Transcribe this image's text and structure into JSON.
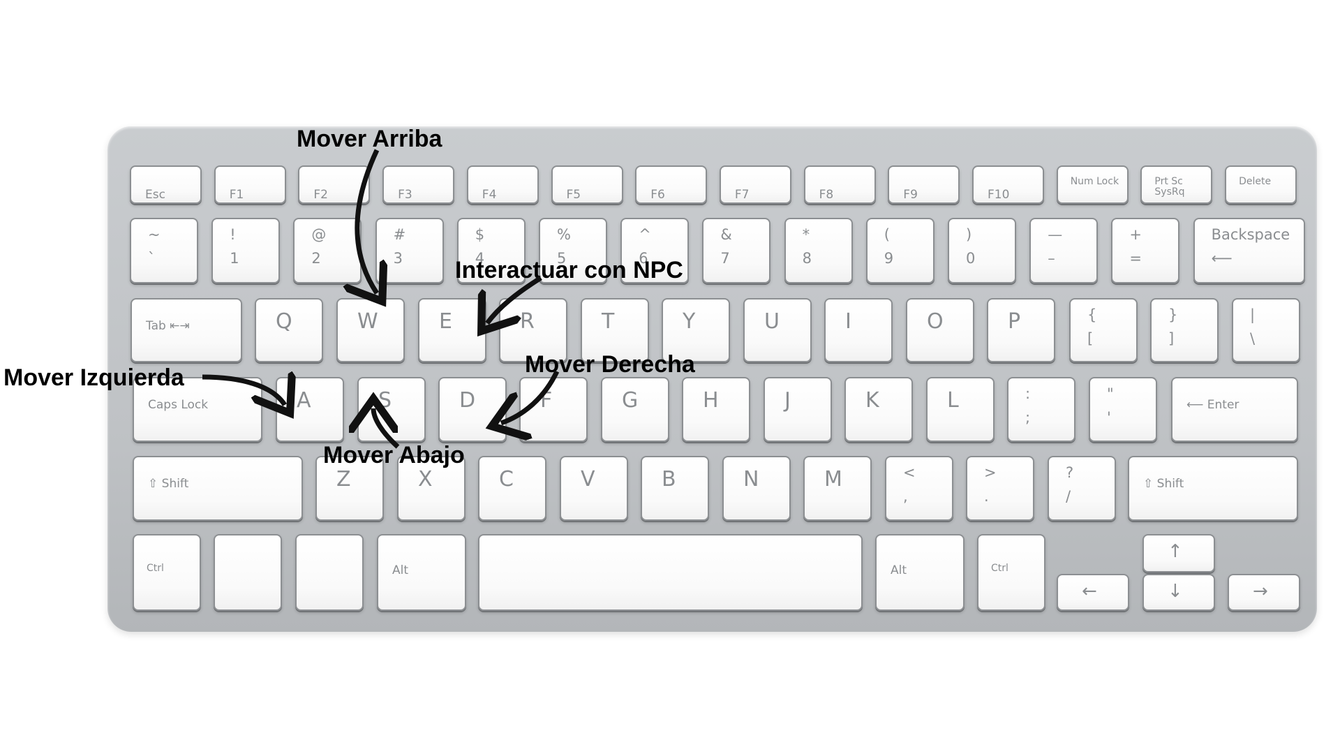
{
  "keyboard": {
    "row_fn": [
      "Esc",
      "F1",
      "F2",
      "F3",
      "F4",
      "F5",
      "F6",
      "F7",
      "F8",
      "F9",
      "F10",
      "Num Lock",
      "Prt Sc SysRq",
      "Delete"
    ],
    "row_num": [
      {
        "top": "~",
        "bottom": "`"
      },
      {
        "top": "!",
        "bottom": "1"
      },
      {
        "top": "@",
        "bottom": "2"
      },
      {
        "top": "#",
        "bottom": "3"
      },
      {
        "top": "$",
        "bottom": "4"
      },
      {
        "top": "%",
        "bottom": "5"
      },
      {
        "top": "^",
        "bottom": "6"
      },
      {
        "top": "&",
        "bottom": "7"
      },
      {
        "top": "*",
        "bottom": "8"
      },
      {
        "top": "(",
        "bottom": "9"
      },
      {
        "top": ")",
        "bottom": "0"
      },
      {
        "top": "—",
        "bottom": "–"
      },
      {
        "top": "+",
        "bottom": "="
      },
      {
        "top": "Backspace",
        "bottom": "⟵"
      }
    ],
    "row_q": [
      {
        "main": "Tab ⇤⇥"
      },
      {
        "main": "Q"
      },
      {
        "main": "W"
      },
      {
        "main": "E"
      },
      {
        "main": "R"
      },
      {
        "main": "T"
      },
      {
        "main": "Y"
      },
      {
        "main": "U"
      },
      {
        "main": "I"
      },
      {
        "main": "O"
      },
      {
        "main": "P"
      },
      {
        "top": "{",
        "bottom": "["
      },
      {
        "top": "}",
        "bottom": "]"
      },
      {
        "top": "|",
        "bottom": "\\"
      }
    ],
    "row_a": [
      {
        "main": "Caps Lock"
      },
      {
        "main": "A"
      },
      {
        "main": "S"
      },
      {
        "main": "D"
      },
      {
        "main": "F"
      },
      {
        "main": "G"
      },
      {
        "main": "H"
      },
      {
        "main": "J"
      },
      {
        "main": "K"
      },
      {
        "main": "L"
      },
      {
        "top": ":",
        "bottom": ";"
      },
      {
        "top": "\"",
        "bottom": "'"
      },
      {
        "main": "⟵ Enter"
      }
    ],
    "row_z": [
      {
        "main": "⇧ Shift"
      },
      {
        "main": "Z"
      },
      {
        "main": "X"
      },
      {
        "main": "C"
      },
      {
        "main": "V"
      },
      {
        "main": "B"
      },
      {
        "main": "N"
      },
      {
        "main": "M"
      },
      {
        "top": "<",
        "bottom": ","
      },
      {
        "top": ">",
        "bottom": "."
      },
      {
        "top": "?",
        "bottom": "/"
      },
      {
        "main": "⇧ Shift"
      }
    ],
    "row_bottom": [
      "Ctrl",
      "",
      "",
      "Alt",
      "",
      "Alt",
      "Ctrl"
    ],
    "arrows": {
      "up": "↑",
      "down": "↓",
      "left": "←",
      "right": "→"
    }
  },
  "annotations": {
    "up": "Mover Arriba",
    "interact": "Interactuar con NPC",
    "left": "Mover Izquierda",
    "right": "Mover Derecha",
    "down": "Mover Abajo"
  },
  "colors": {
    "key_text": "#8a8d90",
    "key_face": "#ffffff",
    "keyboard_frame": "#c4c7ca",
    "annotation_text": "#000000",
    "arrow": "#111111"
  }
}
